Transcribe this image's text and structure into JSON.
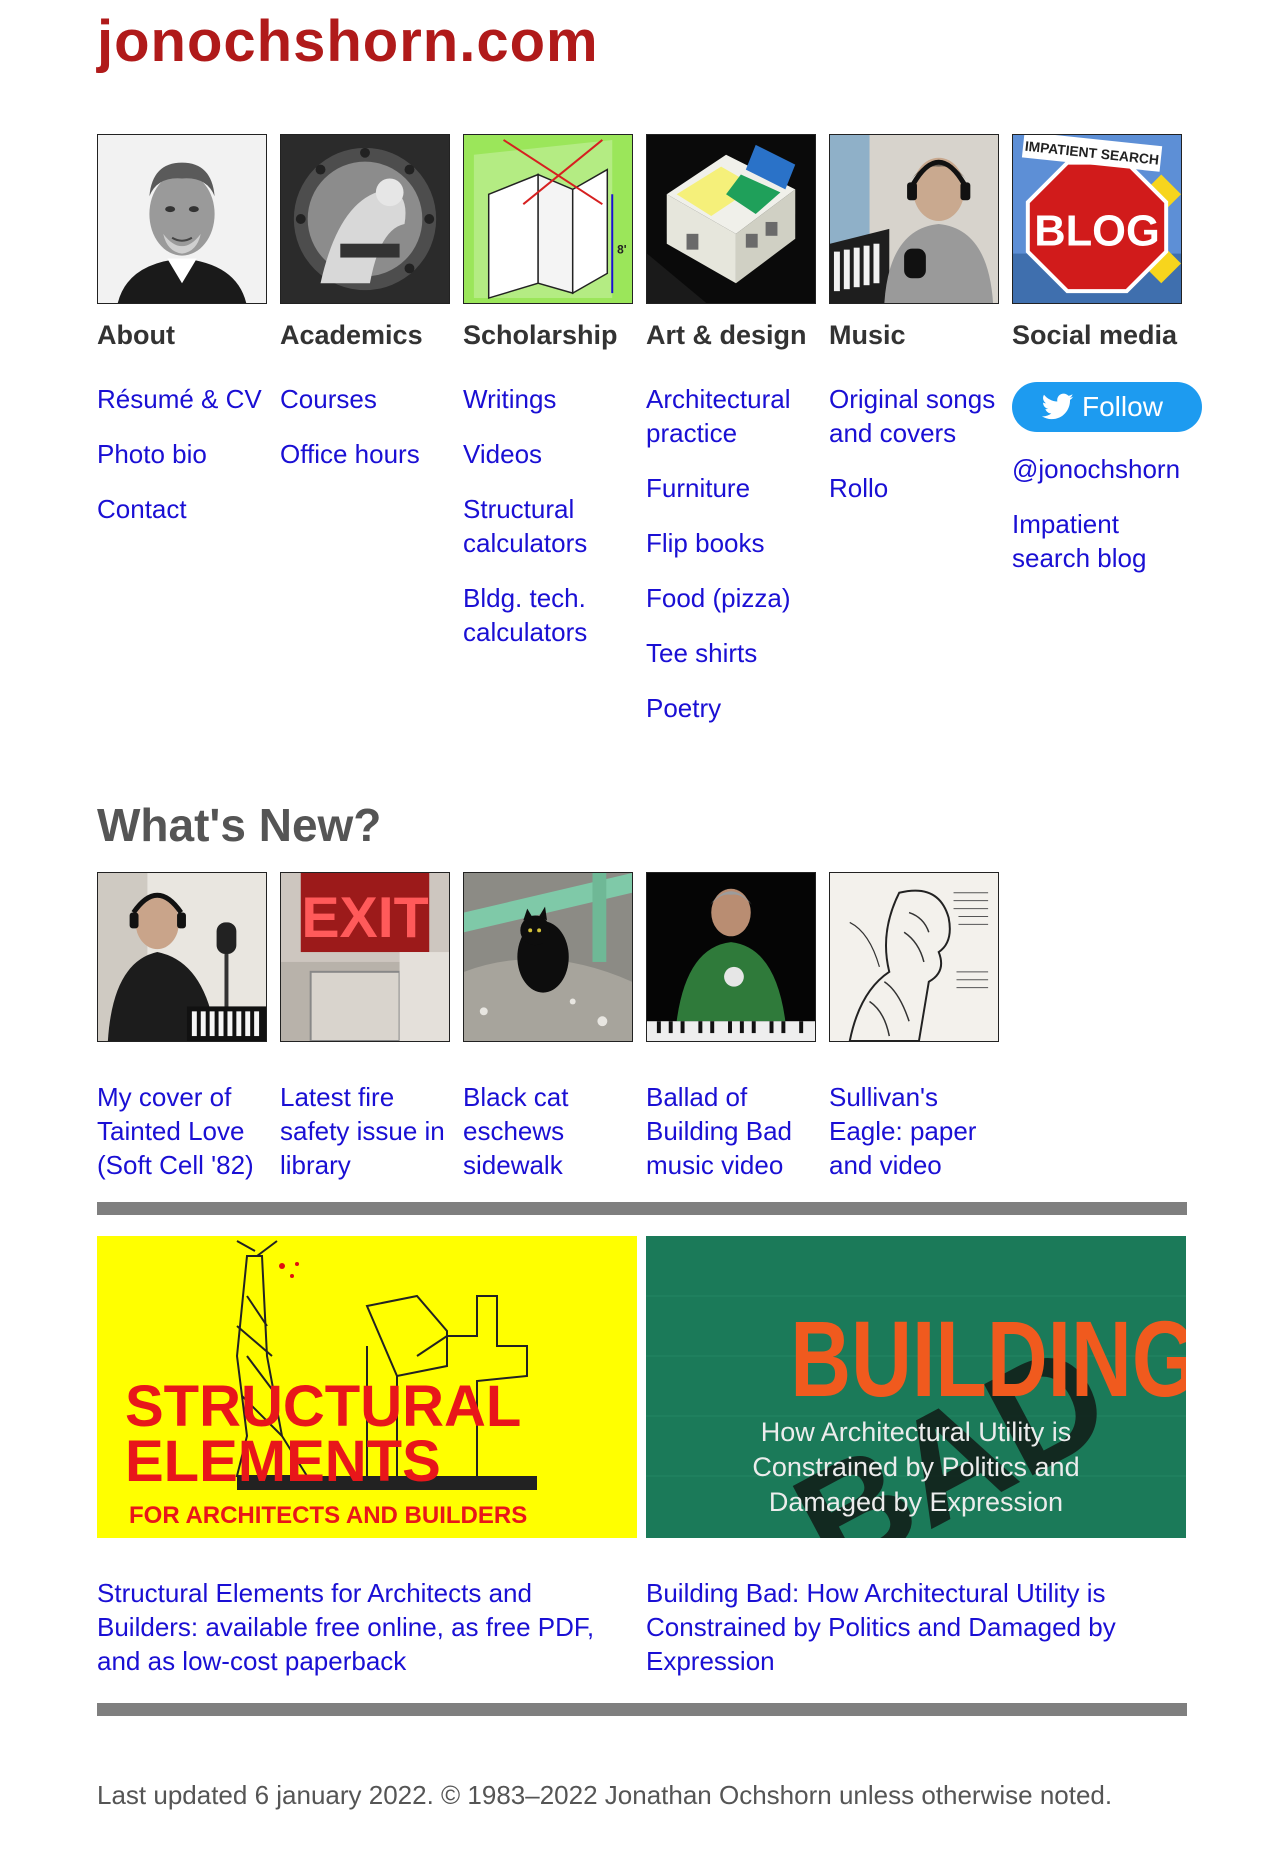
{
  "site": {
    "title": "jonochshorn.com"
  },
  "nav": {
    "about": {
      "heading": "About",
      "links": [
        "Résumé & CV",
        "Photo bio",
        "Contact"
      ]
    },
    "academics": {
      "heading": "Academics",
      "links": [
        "Courses",
        "Office hours"
      ]
    },
    "scholarship": {
      "heading": "Scholarship",
      "links": [
        "Writings",
        "Videos",
        "Structural calculators",
        "Bldg. tech. calculators"
      ],
      "thumb_label": "8'"
    },
    "art": {
      "heading": "Art & design",
      "links": [
        "Architectural practice",
        "Furniture",
        "Flip books",
        "Food (pizza)",
        "Tee shirts",
        "Poetry"
      ]
    },
    "music": {
      "heading": "Music",
      "links": [
        "Original songs and covers",
        "Rollo"
      ]
    },
    "social": {
      "heading": "Social media",
      "follow_label": "Follow",
      "links": [
        "@jonochshorn",
        "Impatient search blog"
      ],
      "thumb_sign_top": "IMPATIENT SEARCH",
      "thumb_sign_main": "BLOG"
    }
  },
  "whats_new": {
    "title": "What's New?",
    "items": [
      {
        "caption": "My cover of Tainted Love (Soft Cell '82)"
      },
      {
        "caption": "Latest fire safety issue in library",
        "sign": "EXIT"
      },
      {
        "caption": "Black cat eschews sidewalk"
      },
      {
        "caption": "Ballad of Building Bad music video"
      },
      {
        "caption": "Sullivan's Eagle: paper and video"
      }
    ]
  },
  "features": {
    "structural": {
      "banner_line1": "STRUCTURAL",
      "banner_line2": "ELEMENTS",
      "banner_line3": "FOR ARCHITECTS AND BUILDERS",
      "caption": "Structural Elements for Architects and Builders: available free online, as free PDF, and as low-cost paperback"
    },
    "building_bad": {
      "banner_word1": "BUILDING",
      "banner_word2": "BAD",
      "banner_sub1": "How Architectural Utility is",
      "banner_sub2": "Constrained by Politics and",
      "banner_sub3": "Damaged by Expression",
      "caption": "Building Bad: How Architectural Utility is Constrained by Politics and Damaged by Expression"
    }
  },
  "footer": {
    "text": "Last updated 6 january 2022. © 1983–2022 Jonathan Ochshorn unless otherwise noted."
  },
  "colors": {
    "title_red": "#b01a1a",
    "link_blue": "#1a0fd4",
    "rule_gray": "#7f7f7f",
    "twitter_blue": "#1d9bf0",
    "banner_yellow": "#ffff00",
    "banner_green": "#1b7a59"
  }
}
